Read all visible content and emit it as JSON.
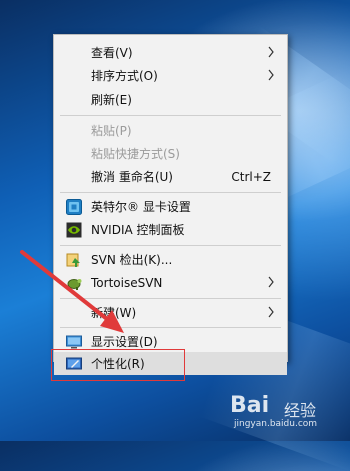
{
  "context_menu": {
    "items": [
      {
        "label": "查看(V)",
        "has_submenu": true,
        "disabled": false
      },
      {
        "label": "排序方式(O)",
        "has_submenu": true,
        "disabled": false
      },
      {
        "label": "刷新(E)",
        "has_submenu": false,
        "disabled": false
      },
      {
        "label": "粘贴(P)",
        "has_submenu": false,
        "disabled": true
      },
      {
        "label": "粘贴快捷方式(S)",
        "has_submenu": false,
        "disabled": true
      },
      {
        "label": "撤消 重命名(U)",
        "shortcut": "Ctrl+Z",
        "disabled": false
      },
      {
        "label": "英特尔® 显卡设置",
        "icon": "intel-graphics-icon",
        "disabled": false
      },
      {
        "label": "NVIDIA 控制面板",
        "icon": "nvidia-icon",
        "disabled": false
      },
      {
        "label": "SVN 检出(K)...",
        "icon": "svn-checkout-icon",
        "disabled": false
      },
      {
        "label": "TortoiseSVN",
        "icon": "tortoisesvn-icon",
        "has_submenu": true,
        "disabled": false
      },
      {
        "label": "新建(W)",
        "has_submenu": true,
        "disabled": false
      },
      {
        "label": "显示设置(D)",
        "icon": "display-settings-icon",
        "disabled": false
      },
      {
        "label": "个性化(R)",
        "icon": "personalize-icon",
        "highlighted": true,
        "disabled": false
      }
    ]
  },
  "annotation": {
    "arrow_color": "#e03a3a",
    "box_color": "#e03a3a"
  },
  "watermark": {
    "brand": "Bai",
    "brand_suffix": "经验",
    "url": "jingyan.baidu.com"
  }
}
